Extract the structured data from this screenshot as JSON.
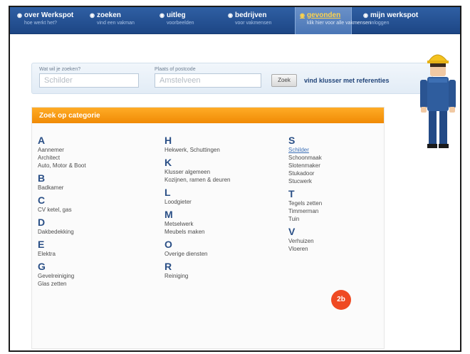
{
  "nav": {
    "items": [
      {
        "label": "over Werkspot",
        "sub": "hoe werkt het?"
      },
      {
        "label": "zoeken",
        "sub": "vind een vakman"
      },
      {
        "label": "uitleg",
        "sub": "voorbeelden"
      },
      {
        "label": "bedrijven",
        "sub": "voor vakmensen"
      },
      {
        "label": "gevonden",
        "sub": "klik hier voor alle vakmensen"
      },
      {
        "label": "mijn werkspot",
        "sub": "inloggen"
      }
    ],
    "active_index": 4
  },
  "search": {
    "what_label": "Wat wil je zoeken?",
    "what_placeholder": "Schilder",
    "where_label": "Plaats of postcode",
    "where_placeholder": "Amstelveen",
    "button_label": "Zoek",
    "help_link": "vind klusser met referenties"
  },
  "categories": {
    "title": "Zoek op categorie",
    "badge": "2b",
    "columns": [
      [
        {
          "letter": "A",
          "items": [
            "Aannemer",
            "Architect",
            "Auto, Motor & Boot"
          ]
        },
        {
          "letter": "B",
          "items": [
            "Badkamer"
          ]
        },
        {
          "letter": "C",
          "items": [
            "CV ketel, gas"
          ]
        },
        {
          "letter": "D",
          "items": [
            "Dakbedekking"
          ]
        },
        {
          "letter": "E",
          "items": [
            "Elektra"
          ]
        },
        {
          "letter": "G",
          "items": [
            "Gevelreiniging",
            "Glas zetten"
          ]
        }
      ],
      [
        {
          "letter": "H",
          "items": [
            "Hekwerk, Schuttingen"
          ]
        },
        {
          "letter": "K",
          "items": [
            "Klusser algemeen",
            "Kozijnen, ramen & deuren"
          ]
        },
        {
          "letter": "L",
          "items": [
            "Loodgieter"
          ]
        },
        {
          "letter": "M",
          "items": [
            "Metselwerk",
            "Meubels maken"
          ]
        },
        {
          "letter": "O",
          "items": [
            "Overige diensten"
          ]
        },
        {
          "letter": "R",
          "items": [
            "Reiniging"
          ]
        }
      ],
      [
        {
          "letter": "S",
          "items": [
            "Schilder",
            "Schoonmaak",
            "Slotenmaker",
            "Stukadoor",
            "Stucwerk"
          ]
        },
        {
          "letter": "T",
          "items": [
            "Tegels zetten",
            "Timmerman",
            "Tuin"
          ]
        },
        {
          "letter": "V",
          "items": [
            "Verhuizen",
            "Vloeren"
          ]
        }
      ]
    ]
  },
  "colors": {
    "nav_blue": "#1d4685",
    "accent_orange": "#f08a05",
    "badge_red": "#ef4a23",
    "letter_blue": "#2a4f86"
  }
}
